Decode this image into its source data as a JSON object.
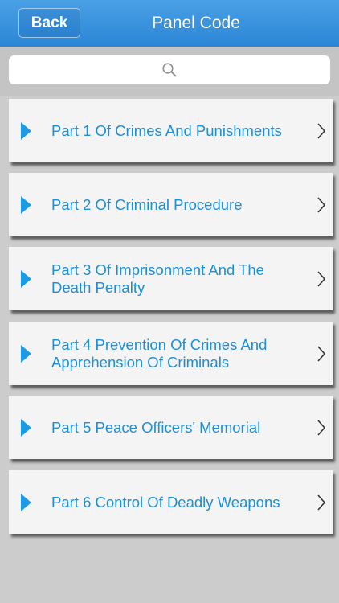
{
  "navbar": {
    "back_label": "Back",
    "title": "Panel Code",
    "color": "#3a93dd"
  },
  "search": {
    "placeholder": "",
    "icon": "search-icon"
  },
  "list": {
    "items": [
      {
        "label": "Part 1 Of Crimes And Punishments",
        "icon": "play-icon"
      },
      {
        "label": "Part 2 Of Criminal Procedure",
        "icon": "play-icon"
      },
      {
        "label": "Part 3 Of Imprisonment And The Death Penalty",
        "icon": "play-icon"
      },
      {
        "label": "Part 4 Prevention Of Crimes And Apprehension Of Criminals",
        "icon": "play-icon"
      },
      {
        "label": "Part 5 Peace Officers' Memorial",
        "icon": "play-icon"
      },
      {
        "label": "Part 6 Control Of Deadly Weapons",
        "icon": "play-icon"
      }
    ],
    "accent_color": "#1d9ae3",
    "chevron_icon": "chevron-right-icon"
  }
}
